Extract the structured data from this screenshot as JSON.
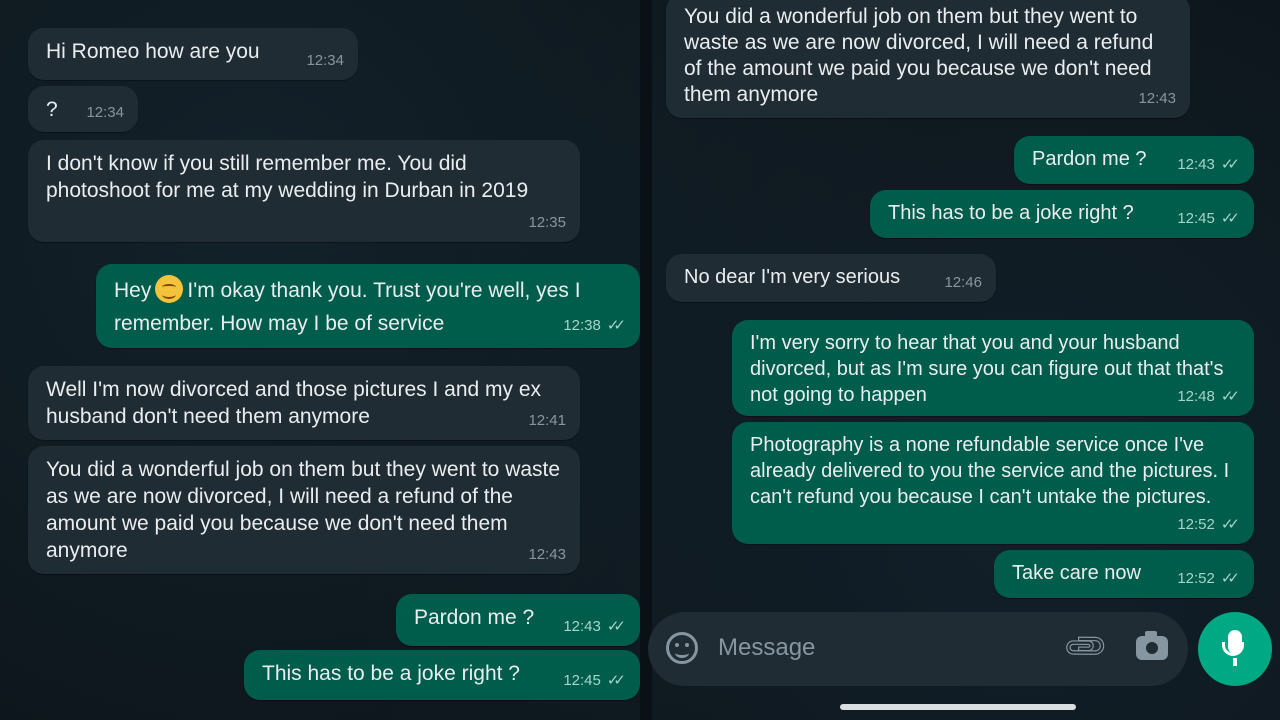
{
  "left_chat": [
    {
      "dir": "in",
      "text": "Hi Romeo how are you",
      "time": "12:34"
    },
    {
      "dir": "in",
      "text": "?",
      "time": "12:34"
    },
    {
      "dir": "in",
      "text": "I don't know if you still remember me. You did photoshoot for me at my wedding in Durban in 2019",
      "time": "12:35"
    },
    {
      "dir": "out",
      "text_before": "Hey",
      "emoji": "smiling-face",
      "text_after": "I'm okay thank you. Trust you're well, yes I remember. How may I be of service",
      "time": "12:38"
    },
    {
      "dir": "in",
      "text": "Well I'm now divorced and those pictures I and my ex husband don't need them anymore",
      "time": "12:41"
    },
    {
      "dir": "in",
      "text": "You did a wonderful job on them but they went to waste as we are now divorced, I will need a refund of the amount we paid you because we don't need them anymore",
      "time": "12:43"
    },
    {
      "dir": "out",
      "text": "Pardon me ?",
      "time": "12:43"
    },
    {
      "dir": "out",
      "text": "This has to be a joke right ?",
      "time": "12:45"
    }
  ],
  "right_chat": [
    {
      "dir": "in",
      "text": "You did a wonderful job on them but they went to waste as we are now divorced, I will need a refund of the amount we paid you because we don't need them anymore",
      "time": "12:43"
    },
    {
      "dir": "out",
      "text": "Pardon me ?",
      "time": "12:43"
    },
    {
      "dir": "out",
      "text": "This has to be a joke right ?",
      "time": "12:45"
    },
    {
      "dir": "in",
      "text": "No dear I'm very serious",
      "time": "12:46"
    },
    {
      "dir": "out",
      "text": "I'm very sorry to hear that you and your husband divorced, but as I'm sure you can figure out that that's not going to happen",
      "time": "12:48"
    },
    {
      "dir": "out",
      "text": "Photography is a none refundable service once I've already delivered to you the service and the pictures. I can't refund you because I can't untake the pictures.",
      "time": "12:52"
    },
    {
      "dir": "out",
      "text": "Take care now",
      "time": "12:52"
    }
  ],
  "composer": {
    "placeholder": "Message",
    "icons": [
      "emoji-icon",
      "attach-icon",
      "camera-icon",
      "mic-icon"
    ]
  },
  "colors": {
    "incoming_bubble": "#202c33",
    "outgoing_bubble": "#005c4b",
    "accent": "#00a884",
    "background": "#0c1419"
  }
}
